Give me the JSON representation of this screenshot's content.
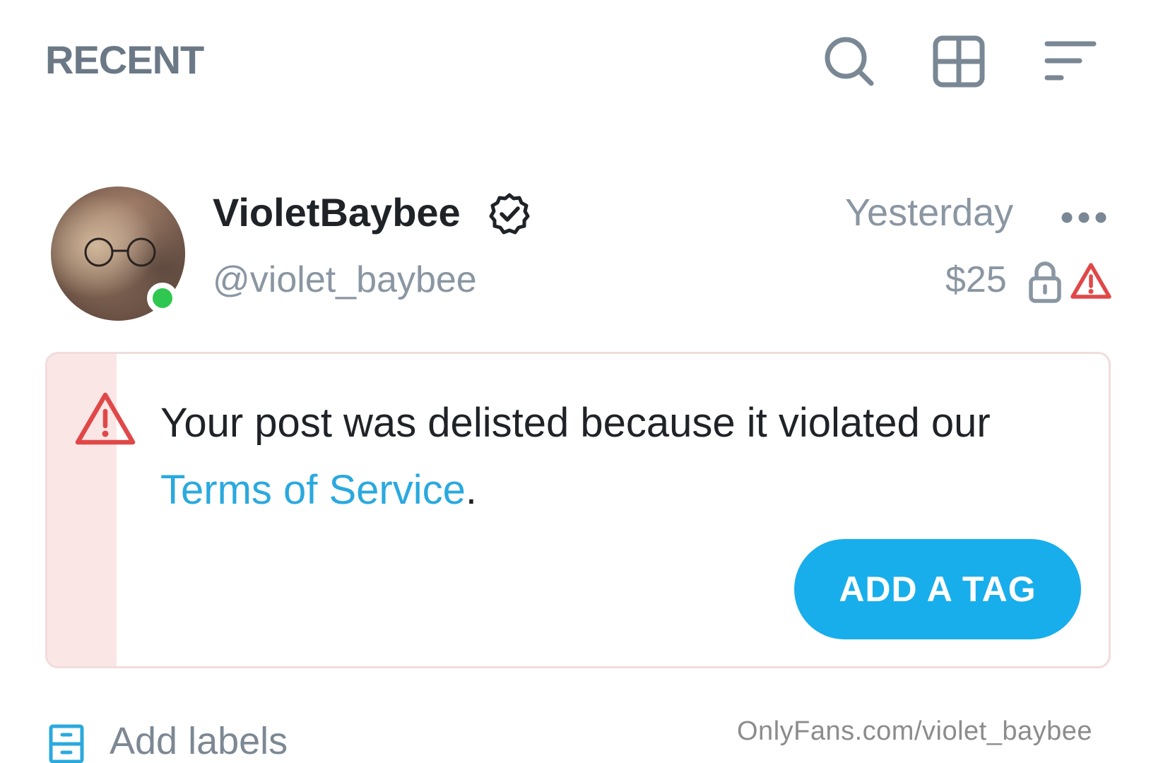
{
  "header": {
    "title": "RECENT",
    "icons": [
      "search-icon",
      "grid-icon",
      "sort-icon"
    ]
  },
  "post": {
    "display_name": "VioletBaybee",
    "handle": "@violet_baybee",
    "timestamp": "Yesterday",
    "price": "$25",
    "online": true,
    "verified": true
  },
  "notice": {
    "text_before": "Your post was delisted because it violated our ",
    "link_text": "Terms of Service",
    "text_after": ".",
    "button_label": "ADD A TAG"
  },
  "footer": {
    "add_labels": "Add labels",
    "watermark": "OnlyFans.com/violet_baybee"
  },
  "colors": {
    "accent": "#18aeec",
    "link": "#2aa9df",
    "warning": "#e04848",
    "online": "#2fc750",
    "muted": "#8a96a2"
  }
}
